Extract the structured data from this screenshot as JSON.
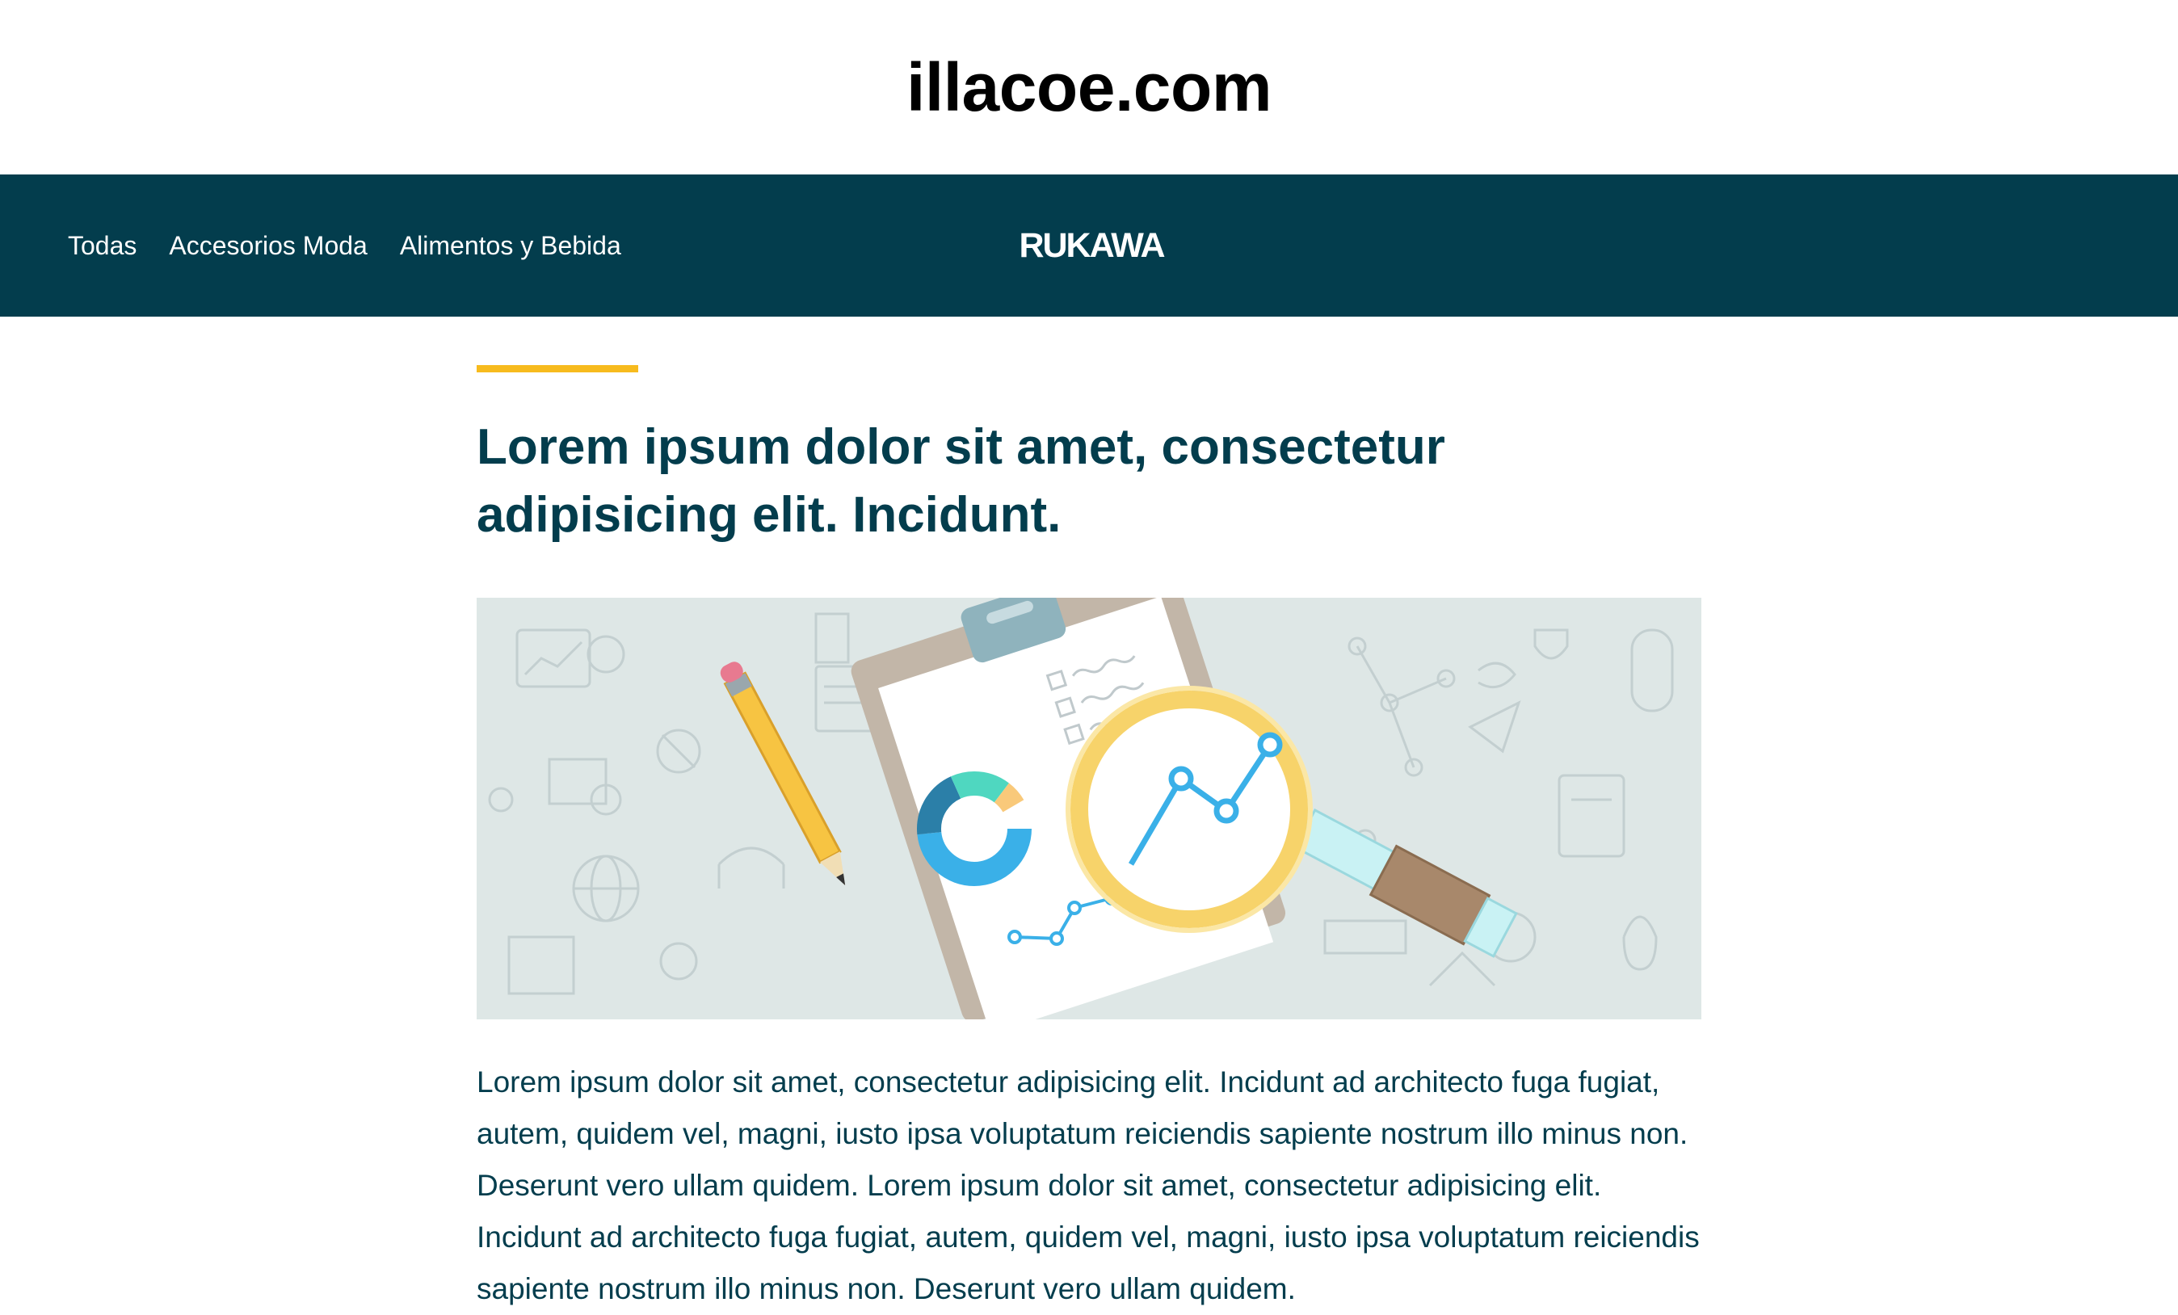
{
  "site": {
    "title": "illacoe.com"
  },
  "nav": {
    "links": [
      {
        "label": "Todas"
      },
      {
        "label": "Accesorios Moda"
      },
      {
        "label": "Alimentos y Bebida"
      }
    ],
    "brand": "RUKAWA"
  },
  "article": {
    "title": "Lorem ipsum dolor sit amet, consectetur adipisicing elit. Incidunt.",
    "body": "Lorem ipsum dolor sit amet, consectetur adipisicing elit. Incidunt ad architecto fuga fugiat, autem, quidem vel, magni, iusto ipsa voluptatum reiciendis sapiente nostrum illo minus non. Deserunt vero ullam quidem. Lorem ipsum dolor sit amet, consectetur adipisicing elit. Incidunt ad architecto fuga fugiat, autem, quidem vel, magni, iusto ipsa voluptatum reiciendis sapiente nostrum illo minus non. Deserunt vero ullam quidem."
  },
  "colors": {
    "navbar": "#033d4d",
    "accent": "#f7bb1e",
    "text": "#033d4d",
    "hero_background": "#dee7e6"
  },
  "hero_image": {
    "icons": [
      "pencil-icon",
      "clipboard-icon",
      "donut-chart-icon",
      "magnifying-glass-icon",
      "line-chart-icon"
    ]
  }
}
